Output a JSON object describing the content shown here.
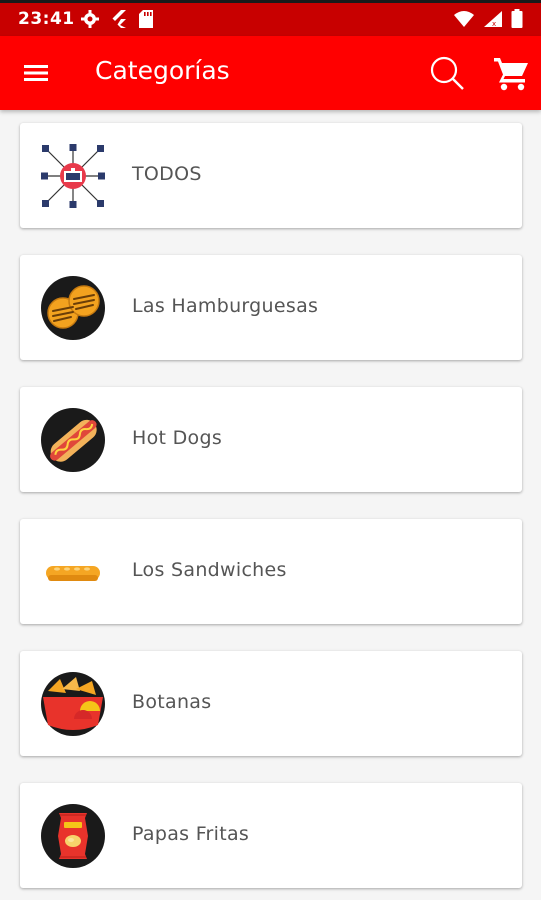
{
  "status_bar": {
    "time": "23:41",
    "icons": [
      "gear-icon",
      "flutter-icon",
      "sd-card-icon",
      "wifi-icon",
      "signal-icon",
      "battery-icon"
    ]
  },
  "app_bar": {
    "title": "Categorías",
    "background_color": "#ff0000",
    "icons": [
      "menu-icon",
      "search-icon",
      "cart-icon"
    ]
  },
  "categories": [
    {
      "label": "TODOS",
      "icon": "network-hub-icon"
    },
    {
      "label": "Las Hamburguesas",
      "icon": "burger-icon"
    },
    {
      "label": "Hot Dogs",
      "icon": "hotdog-icon"
    },
    {
      "label": "Los Sandwiches",
      "icon": "sandwich-icon"
    },
    {
      "label": "Botanas",
      "icon": "snacks-icon"
    },
    {
      "label": "Papas Fritas",
      "icon": "chips-bag-icon"
    }
  ]
}
